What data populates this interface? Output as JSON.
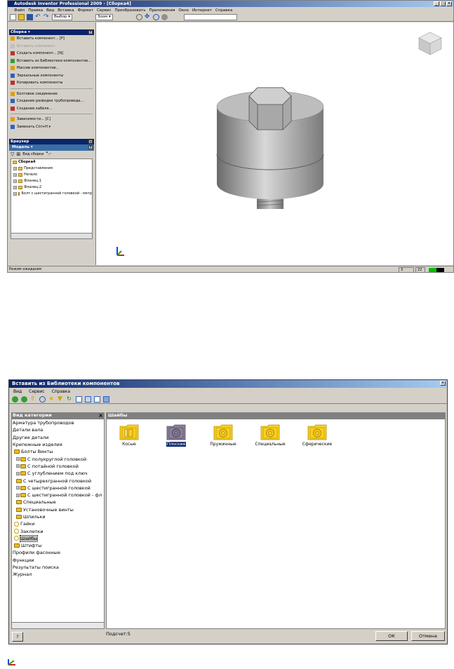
{
  "inventor": {
    "title": "Autodesk Inventor Professional 2009 - [Сборка4]",
    "menu": [
      "Файл",
      "Правка",
      "Вид",
      "Вставка",
      "Формат",
      "Сервис",
      "Преобразовать",
      "Приложения",
      "Окно",
      "Интернет",
      "Справка"
    ],
    "toolbar": {
      "select_label": "Выбор",
      "zoom_label": "Зоом"
    },
    "assembly_panel": {
      "title": "Сборка",
      "commands": [
        {
          "label": "Вставить компонент...   [P]",
          "disabled": false
        },
        {
          "label": "Вставить компонент",
          "disabled": true
        },
        {
          "label": "Создать компонент...   [N]",
          "disabled": false
        },
        {
          "label": "Вставить из Библиотеки компонентов...",
          "disabled": false
        },
        {
          "label": "Массив компонентов...",
          "disabled": false
        },
        {
          "label": "Зеркальные компоненты",
          "disabled": false
        },
        {
          "label": "Копировать компоненты",
          "disabled": false
        }
      ],
      "commands2": [
        {
          "label": "Болтовое соединение"
        },
        {
          "label": "Создание разводки трубопровода..."
        },
        {
          "label": "Создание кабеля..."
        }
      ],
      "commands3": [
        {
          "label": "Зависимости...   [C]"
        },
        {
          "label": "Заменить  Ctrl+H  ▾"
        }
      ]
    },
    "browser": {
      "title": "Браузер",
      "model_label": "Модель ▾",
      "view_label": "Вид сборки",
      "root": "Сборка4",
      "items": [
        "Представления",
        "Начало",
        "Фланец:1",
        "Фланец:2",
        "Болт с шестигранной головкой - метр"
      ]
    },
    "status": {
      "text": "Режим ожидания",
      "cell1": "3",
      "cell2": "22"
    }
  },
  "dialog": {
    "title": "Вставить из Библиотеки компонентов",
    "menu": [
      "Вид",
      "Сервис",
      "Справка"
    ],
    "category_header": "Вид категории",
    "content_header": "Шайбы",
    "categories": [
      {
        "label": "Арматура трубопроводов",
        "level": 0,
        "icon": "none",
        "exp": ""
      },
      {
        "label": "Детали вала",
        "level": 0,
        "icon": "none",
        "exp": ""
      },
      {
        "label": "Другие детали",
        "level": 0,
        "icon": "none",
        "exp": ""
      },
      {
        "label": "Крепежные изделия",
        "level": 0,
        "icon": "none",
        "exp": ""
      },
      {
        "label": "Болты  Винты",
        "level": 1,
        "icon": "group",
        "exp": ""
      },
      {
        "label": "С полукруглой головкой",
        "level": 2,
        "icon": "group",
        "exp": "+"
      },
      {
        "label": "С потайной головкой",
        "level": 2,
        "icon": "group",
        "exp": "+"
      },
      {
        "label": "С углублением под ключ",
        "level": 2,
        "icon": "group",
        "exp": "+"
      },
      {
        "label": "С четырехгранной головкой",
        "level": 2,
        "icon": "group",
        "exp": ""
      },
      {
        "label": "С шестигранной головкой",
        "level": 2,
        "icon": "group",
        "exp": "+"
      },
      {
        "label": "С шестигранной головкой - фл",
        "level": 2,
        "icon": "group",
        "exp": "+"
      },
      {
        "label": "Специальные",
        "level": 2,
        "icon": "group",
        "exp": ""
      },
      {
        "label": "Установочные винты",
        "level": 2,
        "icon": "group",
        "exp": ""
      },
      {
        "label": "Шпильки",
        "level": 2,
        "icon": "group",
        "exp": ""
      },
      {
        "label": "Гайки",
        "level": 1,
        "icon": "ring",
        "exp": ""
      },
      {
        "label": "Заклепки",
        "level": 1,
        "icon": "ring",
        "exp": ""
      },
      {
        "label": "Шайбы",
        "level": 1,
        "icon": "ring",
        "exp": "",
        "selected": true
      },
      {
        "label": "Штифты",
        "level": 1,
        "icon": "group",
        "exp": ""
      },
      {
        "label": "Профили фасонные",
        "level": 0,
        "icon": "none",
        "exp": ""
      },
      {
        "label": "Функции",
        "level": 0,
        "icon": "none",
        "exp": ""
      },
      {
        "label": "Результаты поиска",
        "level": 0,
        "icon": "none",
        "exp": ""
      },
      {
        "label": "Журнал",
        "level": 0,
        "icon": "none",
        "exp": ""
      }
    ],
    "families": [
      {
        "label": "Косые",
        "selected": false
      },
      {
        "label": "Плоские",
        "selected": true
      },
      {
        "label": "Пружинные",
        "selected": false
      },
      {
        "label": "Специальные",
        "selected": false
      },
      {
        "label": "Сферические",
        "selected": false
      }
    ],
    "count_label": "Подсчет:5",
    "ok_label": "ОК",
    "cancel_label": "Отмена",
    "help_label": "?"
  }
}
